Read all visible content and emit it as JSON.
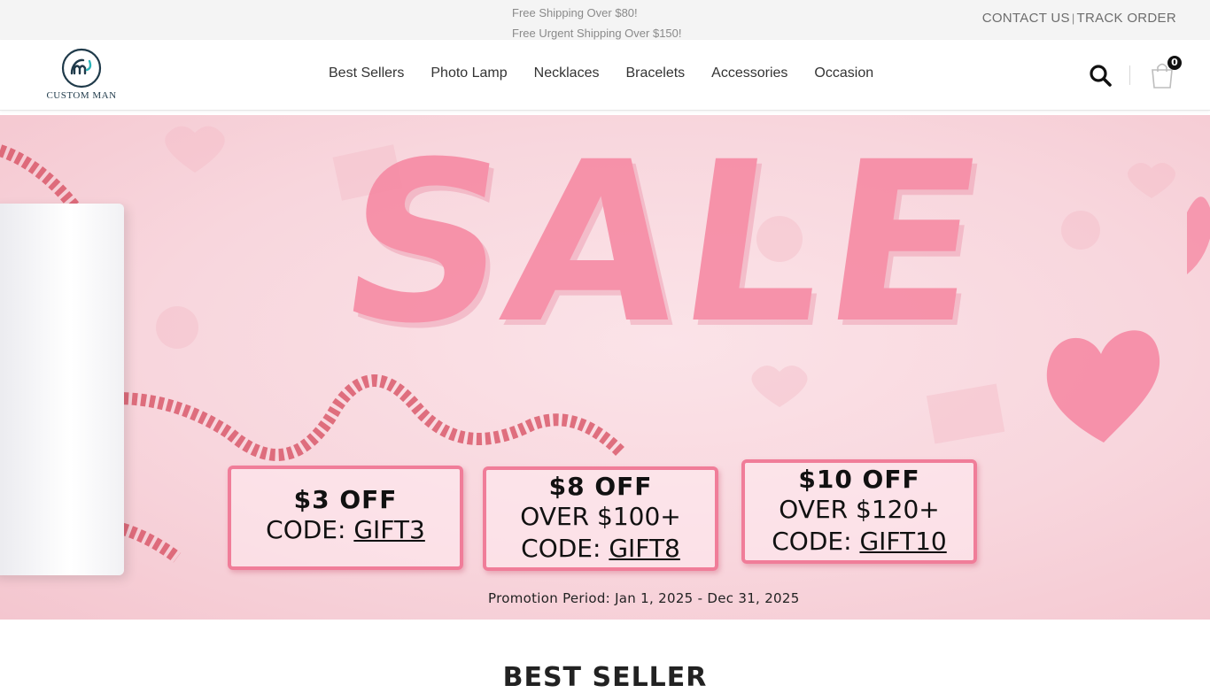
{
  "topbar": {
    "promo_line_1": "Free Shipping Over $80!",
    "promo_line_2": "Free Urgent Shipping Over $150!",
    "contact_label": "CONTACT US",
    "separator": "|",
    "track_label": "TRACK ORDER"
  },
  "header": {
    "logo_text": "CUSTOM MAN",
    "nav": [
      {
        "label": "Best Sellers"
      },
      {
        "label": "Photo Lamp"
      },
      {
        "label": "Necklaces"
      },
      {
        "label": "Bracelets"
      },
      {
        "label": "Accessories"
      },
      {
        "label": "Occasion"
      }
    ],
    "cart_count": "0",
    "icons": {
      "search": "search-icon",
      "cart": "shopping-bag-icon"
    }
  },
  "hero": {
    "headline": "SALE",
    "coupons": [
      {
        "discount": "$3 OFF",
        "condition": "",
        "code_prefix": "CODE: ",
        "code": "GIFT3"
      },
      {
        "discount": "$8 OFF",
        "condition": "OVER $100+",
        "code_prefix": "CODE: ",
        "code": "GIFT8"
      },
      {
        "discount": "$10 OFF",
        "condition": "OVER $120+",
        "code_prefix": "CODE: ",
        "code": "GIFT10"
      }
    ],
    "promotion_period": "Promotion Period: Jan 1, 2025 - Dec 31, 2025"
  },
  "section": {
    "title": "BEST SELLER"
  },
  "colors": {
    "accent_pink": "#f07d99",
    "banner_bg": "#f8d6dd",
    "topbar_bg": "#f4f4f4"
  }
}
